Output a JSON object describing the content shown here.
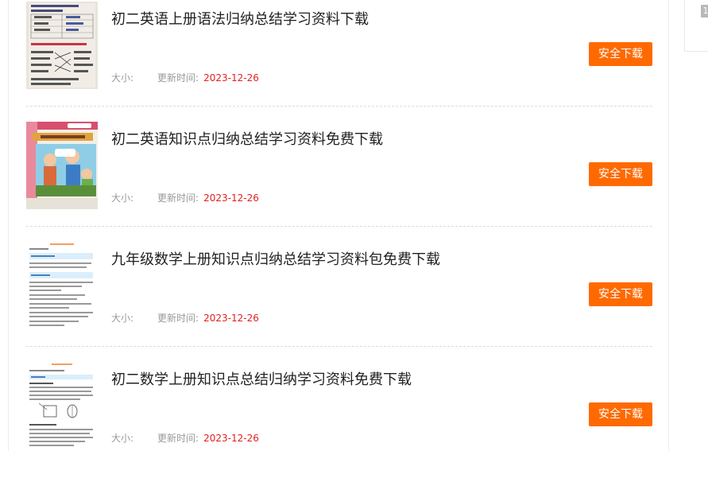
{
  "sidebar": {
    "badge": "1"
  },
  "labels": {
    "size": "大小:",
    "updated": "更新时间:",
    "download": "安全下载"
  },
  "items": [
    {
      "title": "初二英语上册语法归纳总结学习资料下载",
      "date": "2023-12-26"
    },
    {
      "title": "初二英语知识点归纳总结学习资料免费下载",
      "date": "2023-12-26"
    },
    {
      "title": "九年级数学上册知识点归纳总结学习资料包免费下载",
      "date": "2023-12-26"
    },
    {
      "title": "初二数学上册知识点总结归纳学习资料免费下载",
      "date": "2023-12-26"
    }
  ]
}
